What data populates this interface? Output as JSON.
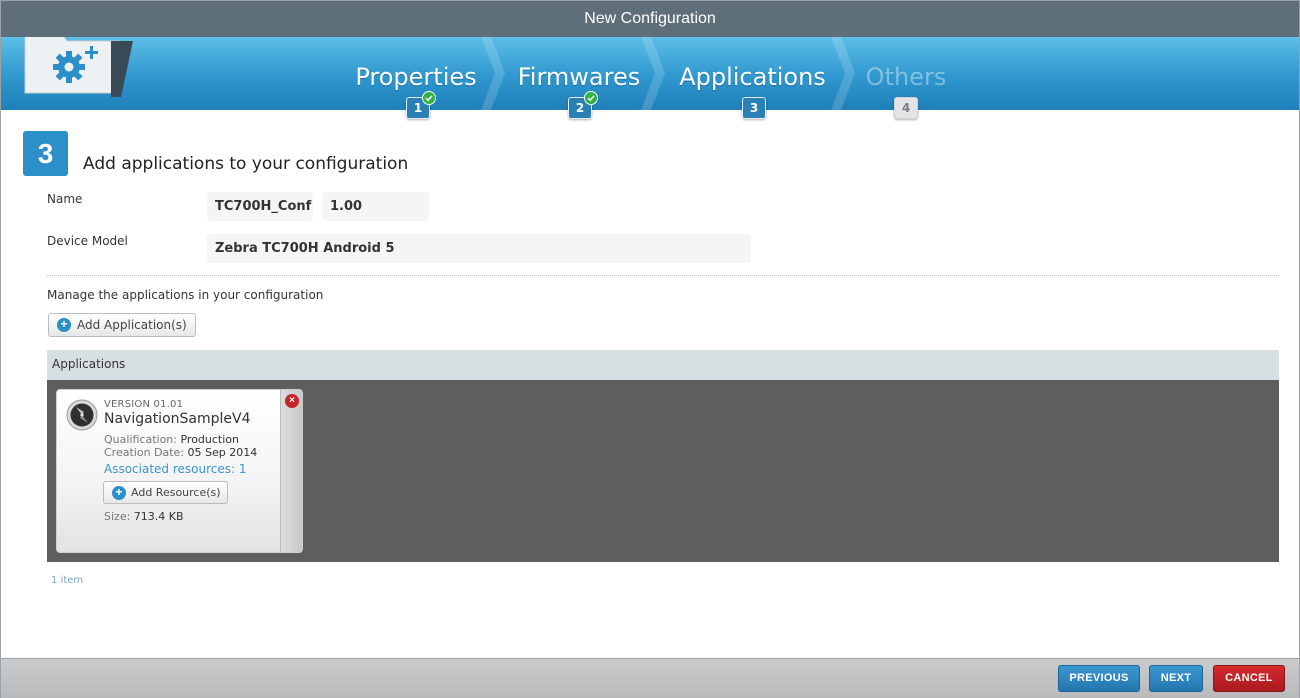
{
  "window": {
    "title": "New Configuration"
  },
  "wizard": {
    "steps": [
      {
        "label": "Properties",
        "number": "1",
        "state": "completed"
      },
      {
        "label": "Firmwares",
        "number": "2",
        "state": "completed"
      },
      {
        "label": "Applications",
        "number": "3",
        "state": "current"
      },
      {
        "label": "Others",
        "number": "4",
        "state": "future"
      }
    ],
    "icon": "folder-gear-plus-icon"
  },
  "content": {
    "step_number": "3",
    "title": "Add applications to your configuration",
    "fields": {
      "name_label": "Name",
      "name_value": "TC700H_Conf",
      "version_value": "1.00",
      "device_label": "Device Model",
      "device_value": "Zebra TC700H Android 5"
    },
    "manage_text": "Manage the applications in your configuration",
    "add_app_button": "Add Application(s)",
    "apps_header": "Applications",
    "item_count": "1 item"
  },
  "app_card": {
    "version": "VERSION 01.01",
    "name": "NavigationSampleV4",
    "qualification_label": "Qualification:",
    "qualification_value": "Production",
    "creation_label": "Creation Date:",
    "creation_value": "05 Sep 2014",
    "associated": "Associated resources: 1",
    "add_resource_button": "Add Resource(s)",
    "size_label": "Size:",
    "size_value": "713.4 KB",
    "close_icon": "×"
  },
  "footer": {
    "previous": "PREVIOUS",
    "next": "NEXT",
    "cancel": "CANCEL"
  },
  "colors": {
    "accent": "#2d8fc8",
    "header_bar": "#5f6f7a",
    "cancel": "#c8242b",
    "check": "#32b14a"
  }
}
